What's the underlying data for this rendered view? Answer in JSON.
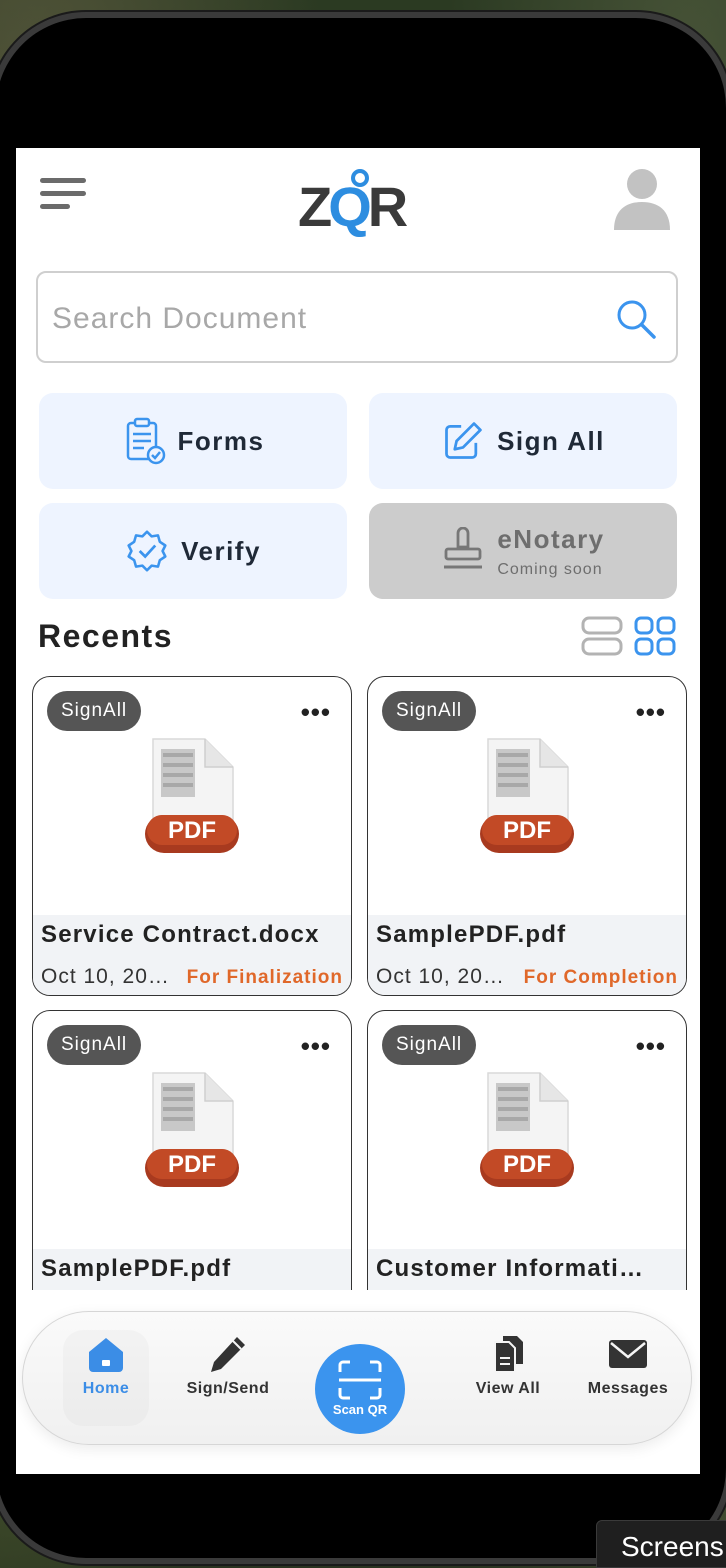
{
  "app": {
    "logo_text_1": "Z",
    "logo_text_q": "Q",
    "logo_text_2": "R"
  },
  "search": {
    "placeholder": "Search Document",
    "value": ""
  },
  "actions": {
    "forms": "Forms",
    "sign_all": "Sign All",
    "verify": "Verify",
    "enotary": "eNotary",
    "enotary_sub": "Coming soon"
  },
  "recents": {
    "title": "Recents",
    "cards": [
      {
        "badge": "SignAll",
        "name": "Service Contract.docx",
        "date": "Oct 10, 20…",
        "status": "For Finalization",
        "file_label": "PDF"
      },
      {
        "badge": "SignAll",
        "name": "SamplePDF.pdf",
        "date": "Oct 10, 20…",
        "status": "For Completion",
        "file_label": "PDF"
      },
      {
        "badge": "SignAll",
        "name": "SamplePDF.pdf",
        "date": "",
        "status": "",
        "file_label": "PDF"
      },
      {
        "badge": "SignAll",
        "name": "Customer Informati…",
        "date": "",
        "status": "",
        "file_label": "PDF"
      }
    ]
  },
  "nav": {
    "home": "Home",
    "sign_send": "Sign/Send",
    "scan_qr": "Scan QR",
    "view_all": "View All",
    "messages": "Messages"
  },
  "overlay": {
    "screens_label": "Screens"
  },
  "colors": {
    "accent": "#3b8de6",
    "status_orange": "#e0682a",
    "tile_bg": "#eef4ff",
    "disabled_bg": "#cccccc"
  }
}
